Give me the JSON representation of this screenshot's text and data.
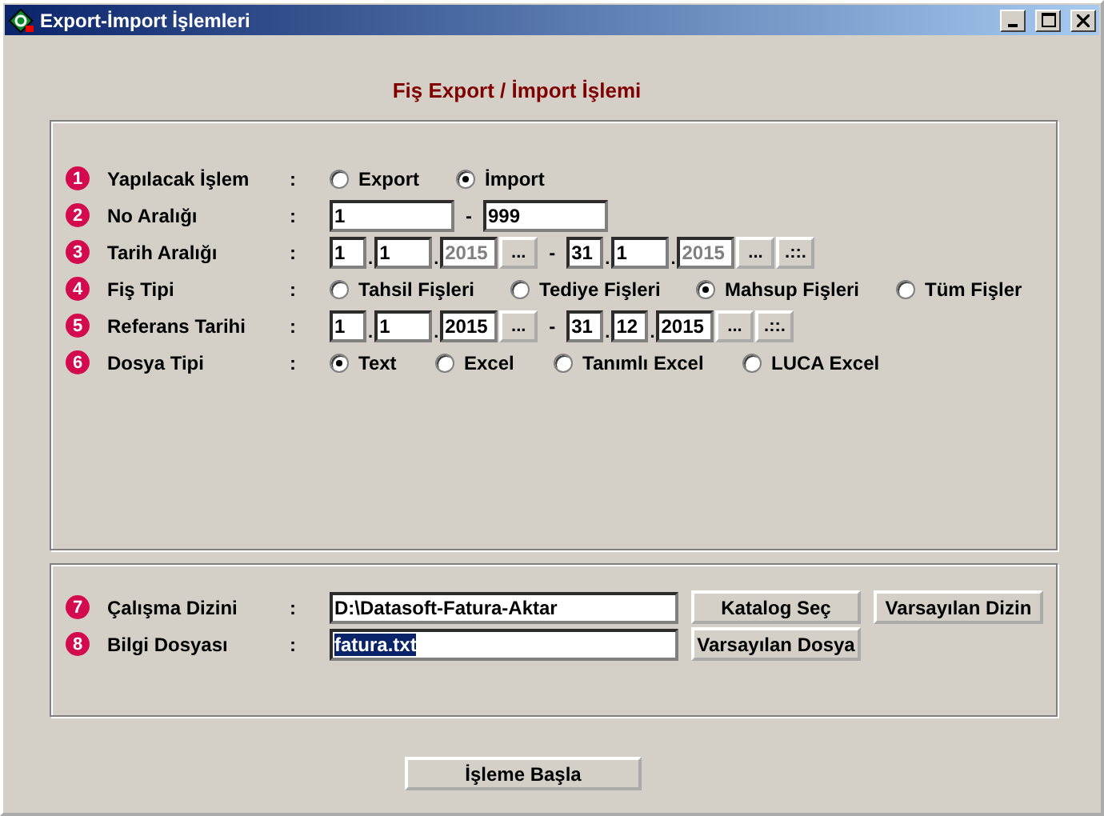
{
  "window": {
    "title": "Export-İmport İşlemleri"
  },
  "heading": "Fiş Export / İmport İşlemi",
  "rows": [
    {
      "number": "1",
      "label": "Yapılacak İşlem",
      "colon": ":",
      "kind": "radio",
      "options": [
        {
          "label": "Export",
          "selected": false
        },
        {
          "label": "İmport",
          "selected": true
        }
      ]
    },
    {
      "number": "2",
      "label": "No Aralığı",
      "colon": ":",
      "kind": "range",
      "from": "1",
      "separator": "-",
      "to": "999"
    },
    {
      "number": "3",
      "label": "Tarih Aralığı",
      "colon": ":",
      "kind": "date-range",
      "start": {
        "day": "1",
        "month": "1",
        "year": "2015",
        "year_disabled": true,
        "dots": [
          ".",
          "."
        ],
        "picker": "..."
      },
      "separator": "-",
      "end": {
        "day": "31",
        "month": "1",
        "year": "2015",
        "year_disabled": true,
        "dots": [
          ".",
          "."
        ],
        "picker": "..."
      },
      "extra": ".::."
    },
    {
      "number": "4",
      "label": "Fiş Tipi",
      "colon": ":",
      "kind": "radio",
      "options": [
        {
          "label": "Tahsil Fişleri",
          "selected": false
        },
        {
          "label": "Tediye Fişleri",
          "selected": false
        },
        {
          "label": "Mahsup Fişleri",
          "selected": true
        },
        {
          "label": "Tüm Fişler",
          "selected": false
        }
      ]
    },
    {
      "number": "5",
      "label": "Referans Tarihi",
      "colon": ":",
      "kind": "date-range",
      "start": {
        "day": "1",
        "month": "1",
        "year": "2015",
        "year_disabled": false,
        "dots": [
          ".",
          "."
        ],
        "picker": "..."
      },
      "separator": "-",
      "end": {
        "day": "31",
        "month": "12",
        "year": "2015",
        "year_disabled": false,
        "dots": [
          ".",
          "."
        ],
        "picker": "..."
      },
      "extra": ".::."
    },
    {
      "number": "6",
      "label": "Dosya Tipi",
      "colon": ":",
      "kind": "radio",
      "options": [
        {
          "label": "Text",
          "selected": true
        },
        {
          "label": "Excel",
          "selected": false
        },
        {
          "label": "Tanımlı Excel",
          "selected": false
        },
        {
          "label": "LUCA Excel",
          "selected": false
        }
      ]
    }
  ],
  "paths": [
    {
      "number": "7",
      "label": "Çalışma Dizini",
      "colon": ":",
      "value": "D:\\Datasoft-Fatura-Aktar",
      "value_selected": false,
      "buttons": [
        "Katalog Seç",
        "Varsayılan Dizin"
      ]
    },
    {
      "number": "8",
      "label": "Bilgi Dosyası",
      "colon": ":",
      "value": "fatura.txt",
      "value_selected": true,
      "buttons": [
        "Varsayılan Dosya"
      ]
    }
  ],
  "start_button": "İşleme Başla"
}
